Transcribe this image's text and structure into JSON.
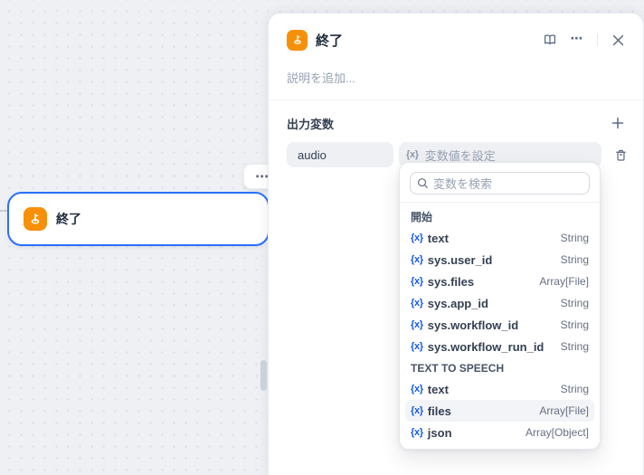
{
  "colors": {
    "accent_blue": "#2970ff",
    "node_orange": "#f79009",
    "variable_blue": "#155aef",
    "canvas_bg": "#eef0f4",
    "field_bg": "#eef0f3",
    "hover_bg": "#f2f4f7"
  },
  "canvas": {
    "node": {
      "title": "終了",
      "icon": "end-flag-icon",
      "selected": true
    },
    "node_menu_label": "⋯"
  },
  "panel": {
    "title": "終了",
    "icon": "end-flag-icon",
    "toolbar": {
      "more_label": "⋯"
    },
    "description_placeholder": "説明を追加...",
    "output_variables": {
      "section_title": "出力変数",
      "rows": [
        {
          "name": "audio",
          "value_prefix": "{x}",
          "value_placeholder": "変数値を設定"
        }
      ]
    }
  },
  "dropdown": {
    "search_placeholder": "変数を検索",
    "variable_glyph": "{x}",
    "groups": [
      {
        "label": "開始",
        "items": [
          {
            "name": "text",
            "type": "String"
          },
          {
            "name": "sys.user_id",
            "type": "String"
          },
          {
            "name": "sys.files",
            "type": "Array[File]"
          },
          {
            "name": "sys.app_id",
            "type": "String"
          },
          {
            "name": "sys.workflow_id",
            "type": "String"
          },
          {
            "name": "sys.workflow_run_id",
            "type": "String"
          }
        ]
      },
      {
        "label": "TEXT TO SPEECH",
        "items": [
          {
            "name": "text",
            "type": "String"
          },
          {
            "name": "files",
            "type": "Array[File]",
            "highlighted": true
          },
          {
            "name": "json",
            "type": "Array[Object]"
          }
        ]
      }
    ]
  }
}
